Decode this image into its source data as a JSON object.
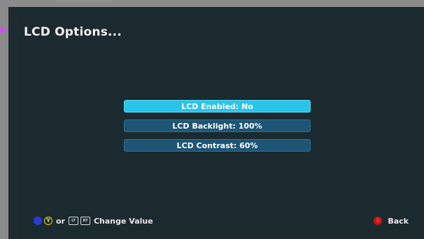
{
  "page": {
    "title": "LCD Options..."
  },
  "options": [
    {
      "label": "LCD Enabled: No",
      "selected": true
    },
    {
      "label": "LCD Backlight: 100%",
      "selected": false
    },
    {
      "label": "LCD Contrast: 60%",
      "selected": false
    }
  ],
  "footer": {
    "x_button_glyph": "X",
    "y_button_glyph": "Y",
    "or_text": "or",
    "lt_button_glyph": "LT",
    "rt_button_glyph": "RT",
    "change_value_text": "Change Value",
    "b_button_glyph": "B",
    "back_text": "Back"
  },
  "colors": {
    "background": "#1b2a2f",
    "option_normal": "#1d5574",
    "option_selected": "#29c4ea",
    "pointer": "#c15bd4",
    "x_button": "#2a3bd8",
    "y_button": "#e2d423",
    "b_button": "#c31515"
  },
  "icons": {
    "pointer": "pointer-arrow-icon",
    "x_button": "x-button-icon",
    "y_button": "y-button-icon",
    "lt_button": "lt-button-icon",
    "rt_button": "rt-button-icon",
    "b_button": "b-button-icon"
  }
}
